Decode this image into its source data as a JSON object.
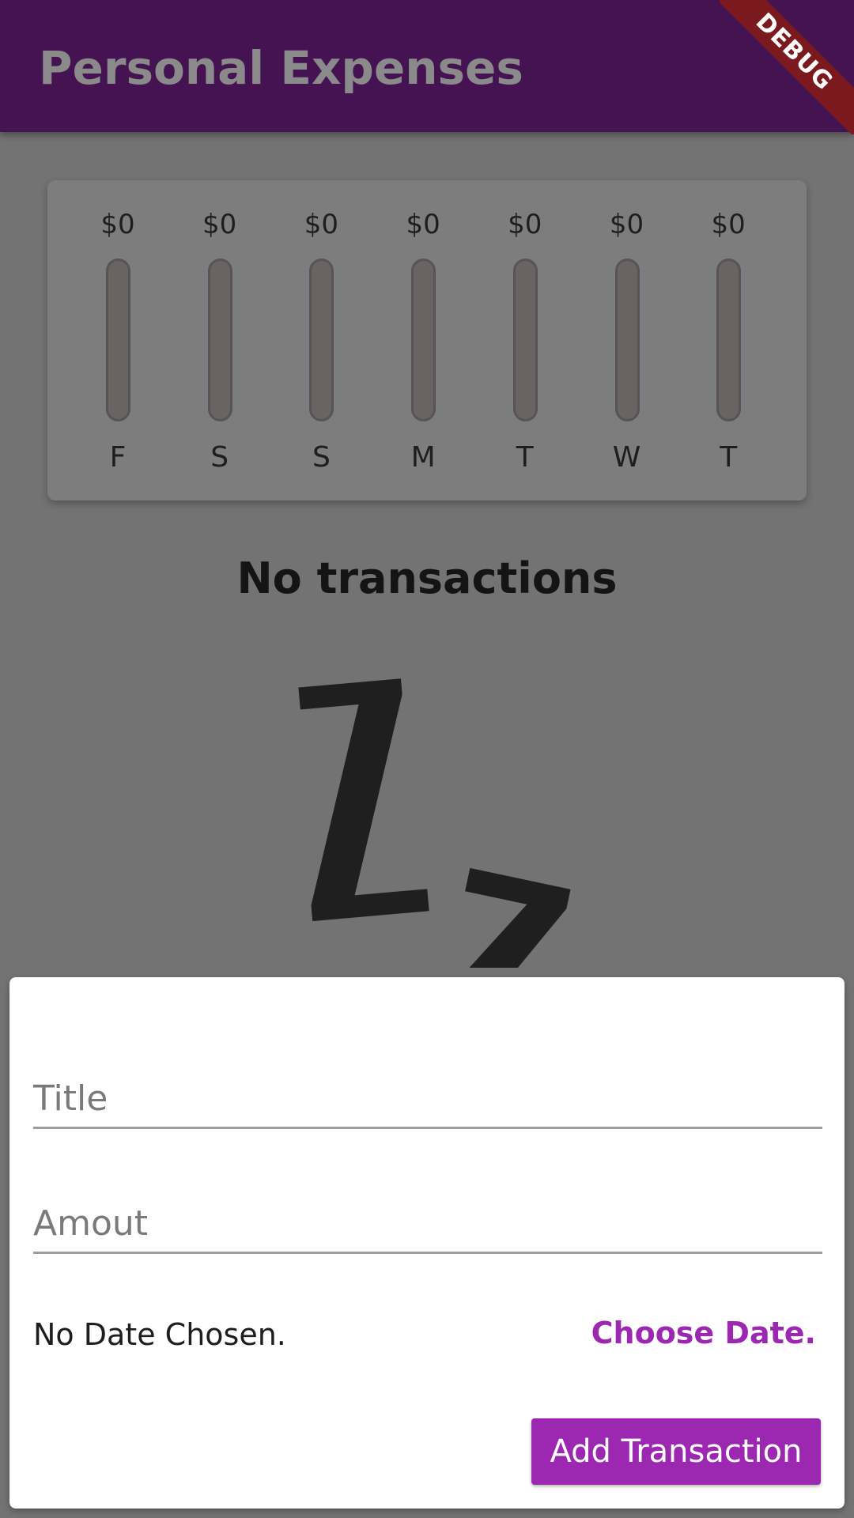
{
  "appbar": {
    "title": "Personal Expenses",
    "debug_label": "DEBUG"
  },
  "chart": {
    "bars": [
      {
        "amount": "$0",
        "day": "F",
        "fraction": 0
      },
      {
        "amount": "$0",
        "day": "S",
        "fraction": 0
      },
      {
        "amount": "$0",
        "day": "S",
        "fraction": 0
      },
      {
        "amount": "$0",
        "day": "M",
        "fraction": 0
      },
      {
        "amount": "$0",
        "day": "T",
        "fraction": 0
      },
      {
        "amount": "$0",
        "day": "W",
        "fraction": 0
      },
      {
        "amount": "$0",
        "day": "T",
        "fraction": 0
      }
    ]
  },
  "empty_state": {
    "title": "No transactions",
    "image": "sleeping-zzz-icon"
  },
  "sheet": {
    "title_placeholder": "Title",
    "amount_placeholder": "Amout",
    "date_text": "No Date Chosen.",
    "choose_date_label": "Choose Date.",
    "add_button_label": "Add Transaction"
  },
  "colors": {
    "appbar": "#461352",
    "accent": "#9c27b0",
    "scrim": "#737373",
    "debug_banner": "#7a1a1e"
  }
}
